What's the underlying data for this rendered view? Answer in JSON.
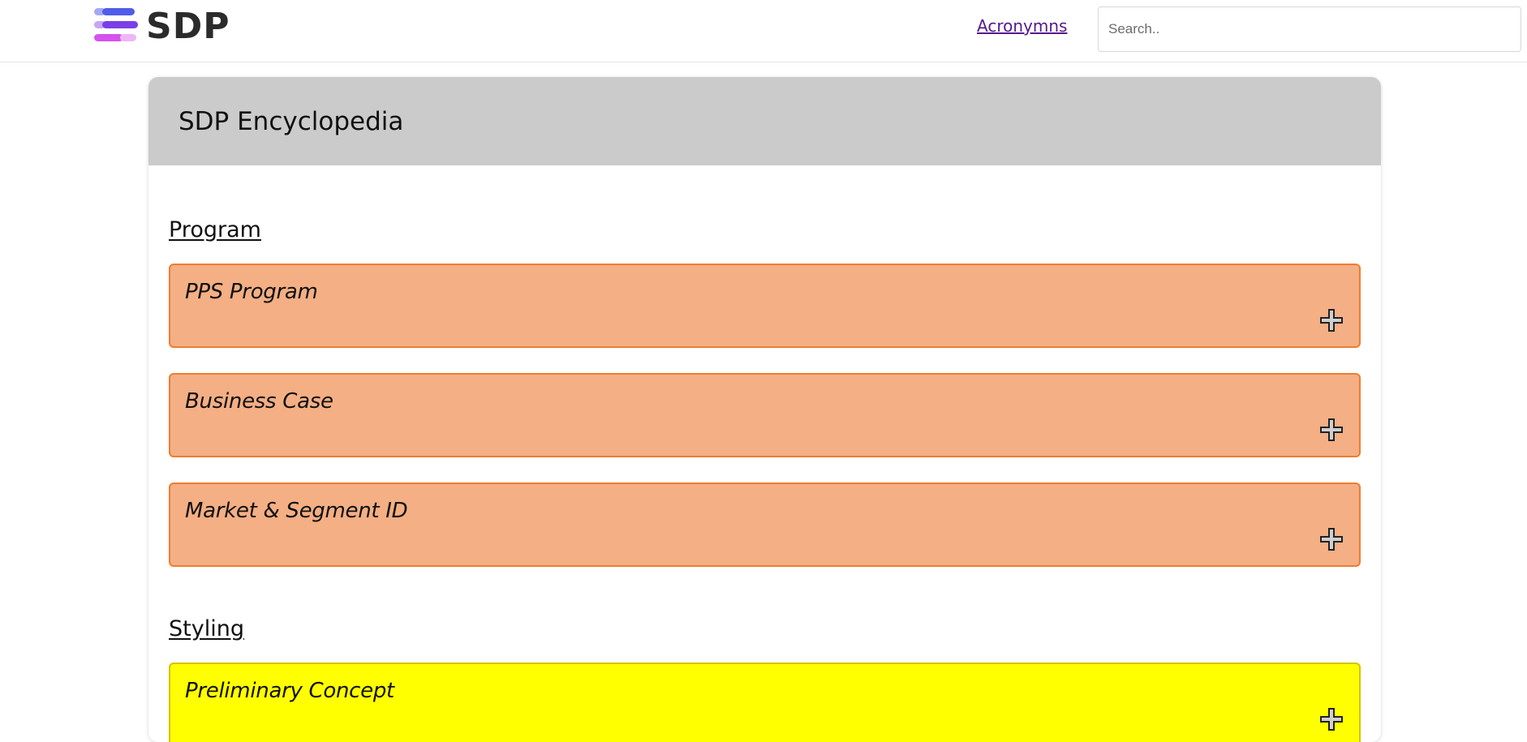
{
  "header": {
    "logo_text": "SDP",
    "nav_link": "Acronymns",
    "search_placeholder": "Search.."
  },
  "card": {
    "title": "SDP Encyclopedia"
  },
  "sections": [
    {
      "heading": "Program",
      "items": [
        {
          "title": "PPS Program",
          "icon": "plus-icon"
        },
        {
          "title": "Business Case",
          "icon": "plus-icon"
        },
        {
          "title": "Market & Segment ID",
          "icon": "plus-icon"
        }
      ]
    },
    {
      "heading": "Styling",
      "items": [
        {
          "title": "Preliminary Concept",
          "icon": "plus-icon"
        }
      ]
    }
  ],
  "colors": {
    "program_item_fill": "#f4af84",
    "program_item_border": "#ed7d31",
    "styling_item_fill": "#ffff00",
    "card_header_fill": "#cbcbcb",
    "link_color": "#551a8b"
  }
}
